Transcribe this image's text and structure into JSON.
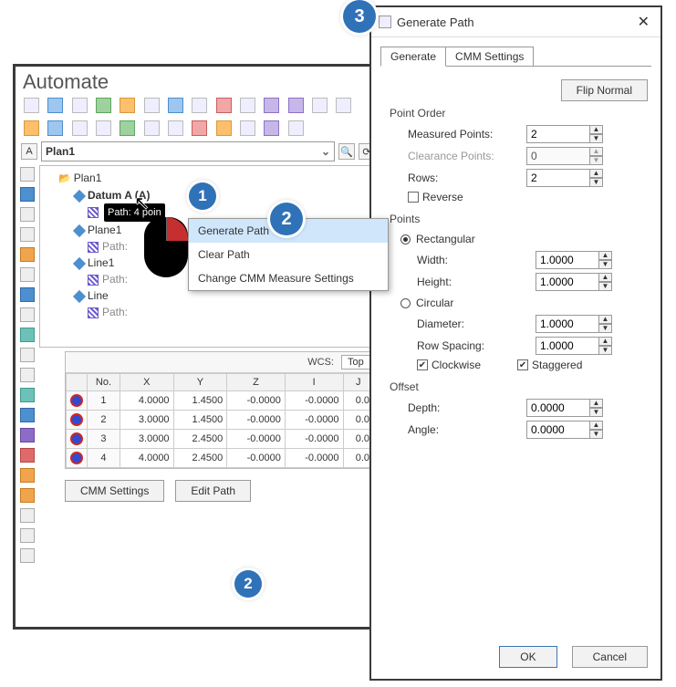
{
  "automate": {
    "title": "Automate",
    "plan_selector_value": "Plan1",
    "tree": {
      "root": "Plan1",
      "items": [
        {
          "label": "Datum A (A)",
          "bold": true,
          "path_chip": "Path: 4 poin"
        },
        {
          "label": "Plane1",
          "path_text": "Path:"
        },
        {
          "label": "Line1",
          "path_text": "Path:"
        },
        {
          "label": "Line",
          "path_text": "Path:"
        }
      ]
    },
    "wcs_label": "WCS:",
    "wcs_value": "Top",
    "grid": {
      "headers": [
        "No.",
        "X",
        "Y",
        "Z",
        "I",
        "J"
      ],
      "rows": [
        {
          "no": "1",
          "x": "4.0000",
          "y": "1.4500",
          "z": "-0.0000",
          "i": "-0.0000",
          "j": "0.0"
        },
        {
          "no": "2",
          "x": "3.0000",
          "y": "1.4500",
          "z": "-0.0000",
          "i": "-0.0000",
          "j": "0.0"
        },
        {
          "no": "3",
          "x": "3.0000",
          "y": "2.4500",
          "z": "-0.0000",
          "i": "-0.0000",
          "j": "0.0"
        },
        {
          "no": "4",
          "x": "4.0000",
          "y": "2.4500",
          "z": "-0.0000",
          "i": "-0.0000",
          "j": "0.0"
        }
      ]
    },
    "buttons": {
      "cmm_settings": "CMM Settings",
      "edit_path": "Edit Path"
    }
  },
  "context_menu": {
    "items": [
      "Generate Path",
      "Clear Path",
      "Change CMM Measure Settings"
    ],
    "highlighted": 0
  },
  "dialog": {
    "title": "Generate Path",
    "tabs": [
      "Generate",
      "CMM Settings"
    ],
    "active_tab": 0,
    "flip_normal": "Flip Normal",
    "groups": {
      "point_order": {
        "title": "Point Order",
        "measured_label": "Measured Points:",
        "measured_value": "2",
        "clearance_label": "Clearance Points:",
        "clearance_value": "0",
        "rows_label": "Rows:",
        "rows_value": "2",
        "reverse_label": "Reverse",
        "reverse_checked": false
      },
      "points": {
        "title": "Points",
        "rect_label": "Rectangular",
        "rect_selected": true,
        "width_label": "Width:",
        "width_value": "1.0000",
        "height_label": "Height:",
        "height_value": "1.0000",
        "circ_label": "Circular",
        "circ_selected": false,
        "diameter_label": "Diameter:",
        "diameter_value": "1.0000",
        "rowspacing_label": "Row Spacing:",
        "rowspacing_value": "1.0000",
        "clockwise_label": "Clockwise",
        "clockwise_checked": true,
        "staggered_label": "Staggered",
        "staggered_checked": true
      },
      "offset": {
        "title": "Offset",
        "depth_label": "Depth:",
        "depth_value": "0.0000",
        "angle_label": "Angle:",
        "angle_value": "0.0000"
      }
    },
    "buttons": {
      "ok": "OK",
      "cancel": "Cancel"
    }
  },
  "callouts": {
    "c1": "1",
    "c2": "2",
    "c3": "3"
  }
}
